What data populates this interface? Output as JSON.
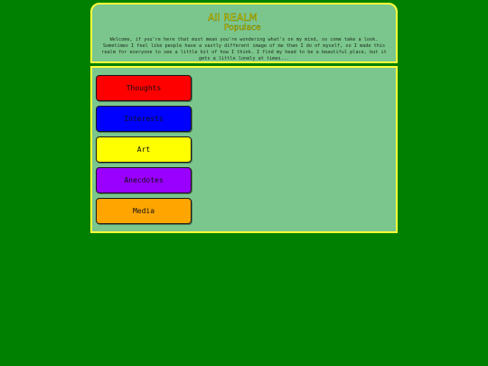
{
  "logo": {
    "line1": "All REALM",
    "line2": "Populace"
  },
  "intro": "Welcome, if you're here that must mean you're wondering what's on my mind, so come take a look. Sometimes I feel like people have a vastly different image of me than I do of myself, so I made this realm for everyone to see a little bit of how I think. I find my head to be a beautiful place, but it gets a little lonely at times...",
  "nav": [
    {
      "label": "Thoughts",
      "color": "#ff0000"
    },
    {
      "label": "Interests",
      "color": "#0000ff"
    },
    {
      "label": "Art",
      "color": "#ffff00"
    },
    {
      "label": "Anecdotes",
      "color": "#9900ff"
    },
    {
      "label": "Media",
      "color": "#ffa500"
    }
  ],
  "colors": {
    "background": "#008000",
    "panel": "#7bc68c",
    "border": "#ffff3a"
  }
}
